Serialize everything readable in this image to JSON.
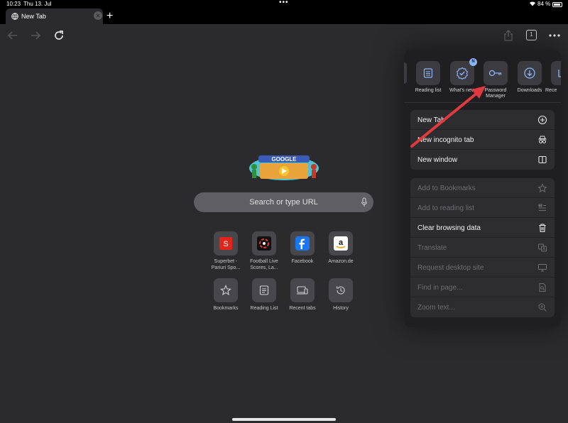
{
  "status_bar": {
    "time": "10:23",
    "date": "Thu 13. Jul",
    "battery": "84 %"
  },
  "tab": {
    "title": "New Tab",
    "close": "×"
  },
  "toolbar": {
    "tab_count": "1"
  },
  "search": {
    "placeholder": "Search or type URL"
  },
  "doodle_text": "GOOGLE",
  "shortcuts": [
    {
      "label": "Superbet - Pariuri Spo...",
      "icon": "superbet-logo"
    },
    {
      "label": "Football Live Scores, La...",
      "icon": "football-live-logo"
    },
    {
      "label": "Facebook",
      "icon": "facebook-logo"
    },
    {
      "label": "Amazon.de",
      "icon": "amazon-logo"
    },
    {
      "label": "Bookmarks",
      "icon": "star-icon"
    },
    {
      "label": "Reading List",
      "icon": "reading-list-icon"
    },
    {
      "label": "Recent tabs",
      "icon": "recent-tabs-icon"
    },
    {
      "label": "History",
      "icon": "history-icon"
    }
  ],
  "menu": {
    "tiles": [
      {
        "label": "Reading list",
        "icon": "reading-list-icon"
      },
      {
        "label": "What's new",
        "icon": "badge-check-icon",
        "badge": "N"
      },
      {
        "label": "Password Manager",
        "icon": "key-icon"
      },
      {
        "label": "Downloads",
        "icon": "download-icon"
      },
      {
        "label": "Rece",
        "icon": "recent-tabs-icon"
      }
    ],
    "group1": [
      {
        "label": "New Tab",
        "icon": "plus-circle-icon"
      },
      {
        "label": "New incognito tab",
        "icon": "incognito-icon"
      },
      {
        "label": "New window",
        "icon": "window-icon"
      }
    ],
    "group2": [
      {
        "label": "Add to Bookmarks",
        "icon": "star-icon",
        "enabled": false
      },
      {
        "label": "Add to reading list",
        "icon": "reading-list-add-icon",
        "enabled": false
      },
      {
        "label": "Clear browsing data",
        "icon": "trash-icon",
        "enabled": true
      },
      {
        "label": "Translate",
        "icon": "translate-icon",
        "enabled": false
      },
      {
        "label": "Request desktop site",
        "icon": "desktop-icon",
        "enabled": false
      },
      {
        "label": "Find in page...",
        "icon": "find-in-page-icon",
        "enabled": false
      },
      {
        "label": "Zoom text...",
        "icon": "zoom-icon",
        "enabled": false
      }
    ]
  },
  "colors": {
    "background": "#2b2b2d",
    "menu": "#1f1f21",
    "accent_arrow": "#e03a3e"
  }
}
